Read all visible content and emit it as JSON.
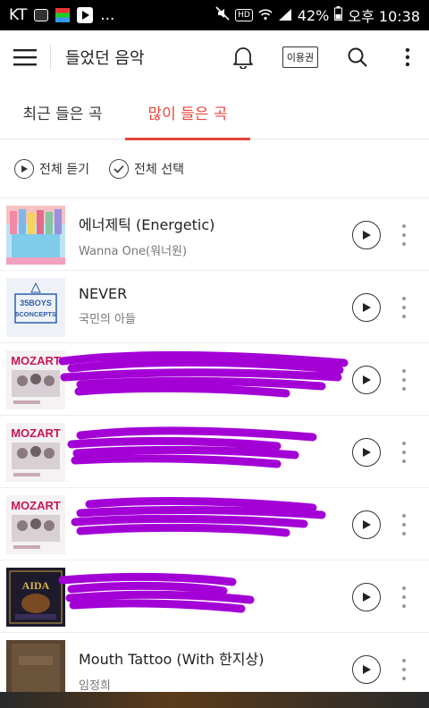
{
  "status": {
    "carrier": "KT",
    "battery": "42%",
    "time": "오후 10:38",
    "hd": "HD",
    "ellipsis": "..."
  },
  "appbar": {
    "title": "들었던 음악",
    "ticket_label": "이용권"
  },
  "tabs": [
    {
      "label": "최근 들은 곡"
    },
    {
      "label": "많이 들은 곡"
    }
  ],
  "actions": {
    "play_all": "전체 듣기",
    "select_all": "전체 선택"
  },
  "songs": [
    {
      "title": "에너제틱 (Energetic)",
      "artist": "Wanna One(워너원)"
    },
    {
      "title": "NEVER",
      "artist": "국민의 아들"
    },
    {
      "title": "",
      "artist": "",
      "redacted": true
    },
    {
      "title": "",
      "artist": "",
      "redacted": true
    },
    {
      "title": "",
      "artist": "",
      "redacted": true
    },
    {
      "title": "",
      "artist": "",
      "redacted": true
    },
    {
      "title": "Mouth Tattoo (With 한지상)",
      "artist": "임정희"
    }
  ],
  "album_art": {
    "never_text_1": "35BOYS",
    "never_text_2": "5CONCEPTS",
    "mozart": "MOZART",
    "aida": "AIDA"
  },
  "colors": {
    "accent": "#e8453c",
    "redaction": "#a300d6"
  }
}
